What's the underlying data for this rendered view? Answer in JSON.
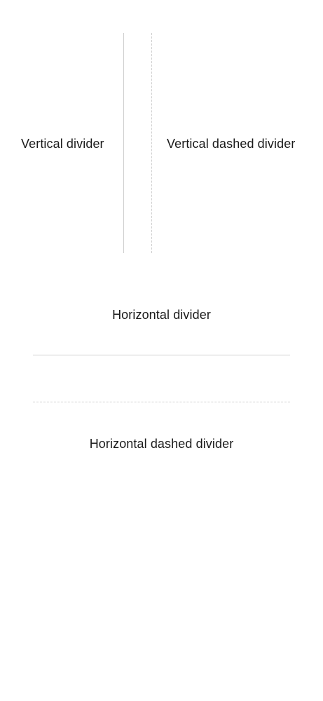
{
  "labels": {
    "vertical": "Vertical divider",
    "vertical_dashed": "Vertical dashed divider",
    "horizontal": "Horizontal divider",
    "horizontal_dashed": "Horizontal dashed divider"
  },
  "colors": {
    "text": "#1a1a1a",
    "divider": "#cfcfcf",
    "background": "#ffffff"
  }
}
